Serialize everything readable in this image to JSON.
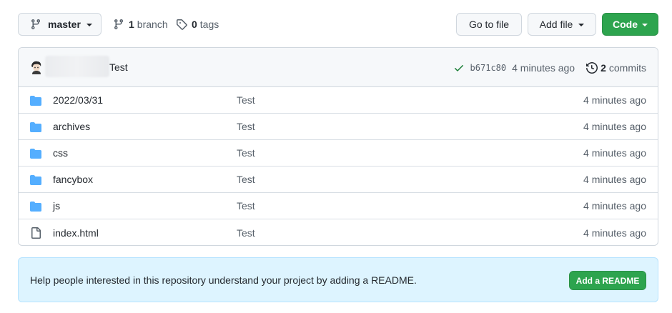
{
  "toolbar": {
    "branch_label": "master",
    "branches_count": "1",
    "branches_label": "branch",
    "tags_count": "0",
    "tags_label": "tags",
    "go_to_file_label": "Go to file",
    "add_file_label": "Add file",
    "code_label": "Code"
  },
  "latest_commit": {
    "message": "Test",
    "sha": "b671c80",
    "time": "4 minutes ago",
    "commits_count": "2",
    "commits_label": "commits"
  },
  "files": [
    {
      "name": "2022/03/31",
      "type": "folder",
      "message": "Test",
      "time": "4 minutes ago"
    },
    {
      "name": "archives",
      "type": "folder",
      "message": "Test",
      "time": "4 minutes ago"
    },
    {
      "name": "css",
      "type": "folder",
      "message": "Test",
      "time": "4 minutes ago"
    },
    {
      "name": "fancybox",
      "type": "folder",
      "message": "Test",
      "time": "4 minutes ago"
    },
    {
      "name": "js",
      "type": "folder",
      "message": "Test",
      "time": "4 minutes ago"
    },
    {
      "name": "index.html",
      "type": "file",
      "message": "Test",
      "time": "4 minutes ago"
    }
  ],
  "readme_banner": {
    "text": "Help people interested in this repository understand your project by adding a README.",
    "button_label": "Add a README"
  },
  "icons": {
    "branch": "git-branch-icon",
    "tag": "tag-icon",
    "check": "check-icon",
    "history": "history-icon",
    "folder": "folder-icon",
    "file": "file-icon"
  },
  "colors": {
    "primary_green": "#2da44e",
    "folder_blue": "#54aeff",
    "banner_bg": "#ddf4ff",
    "check_green": "#1a7f37"
  }
}
